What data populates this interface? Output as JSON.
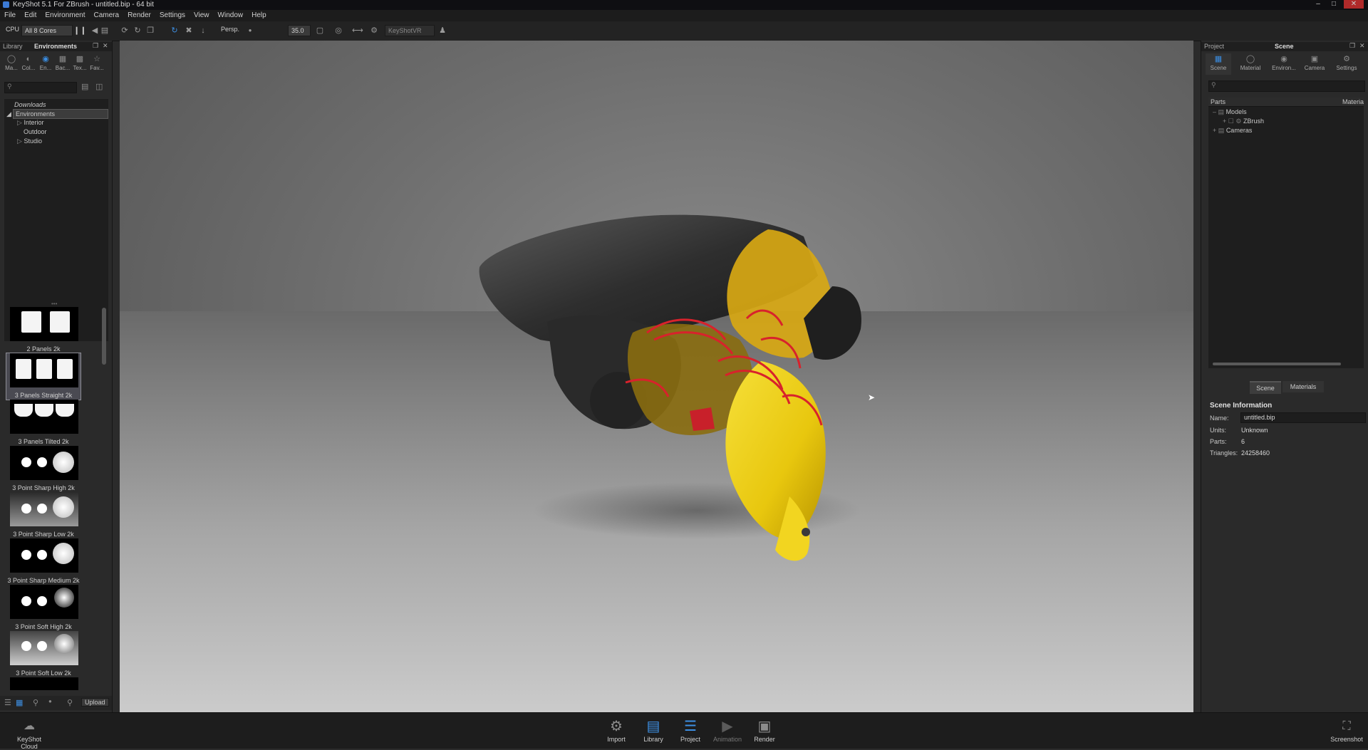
{
  "window": {
    "title": "KeyShot 5.1 For ZBrush - untitled.bip - 64 bit"
  },
  "menu": [
    "File",
    "Edit",
    "Environment",
    "Camera",
    "Render",
    "Settings",
    "View",
    "Window",
    "Help"
  ],
  "toolbar": {
    "cpu_label": "CPU",
    "cores_value": "All 8 Cores",
    "view_mode": "Persp.",
    "focal_length": "35.0",
    "keyshotvr_label": "KeyShotVR"
  },
  "left_panel": {
    "header_left": "Library",
    "header_title": "Environments",
    "tabs": [
      "Ma...",
      "Col...",
      "En...",
      "Bac...",
      "Tex...",
      "Fav..."
    ],
    "tree": {
      "downloads": "Downloads",
      "root": "Environments",
      "children": [
        "Interior",
        "Outdoor",
        "Studio"
      ]
    },
    "thumbnails": [
      "2 Panels 2k",
      "3 Panels Straight 2k",
      "3 Panels Tilted 2k",
      "3 Point Sharp High 2k",
      "3 Point Sharp Low 2k",
      "3 Point Sharp Medium 2k",
      "3 Point Soft High 2k",
      "3 Point Soft Low 2k"
    ],
    "upload_label": "Upload"
  },
  "right_panel": {
    "header_left": "Project",
    "header_title": "Scene",
    "tabs": [
      "Scene",
      "Material",
      "Environ...",
      "Camera",
      "Settings"
    ],
    "tree_columns": [
      "Parts",
      "Materia"
    ],
    "tree": {
      "models": "Models",
      "zbrush": "ZBrush",
      "cameras": "Cameras"
    },
    "subtabs": [
      "Scene",
      "Materials"
    ],
    "scene_info": {
      "heading": "Scene Information",
      "name_label": "Name:",
      "name_value": "untitled.bip",
      "units_label": "Units:",
      "units_value": "Unknown",
      "parts_label": "Parts:",
      "parts_value": "6",
      "triangles_label": "Triangles:",
      "triangles_value": "24258460"
    }
  },
  "bottom_bar": {
    "cloud": "KeyShot Cloud",
    "buttons": [
      "Import",
      "Library",
      "Project",
      "Animation",
      "Render"
    ],
    "screenshot": "Screenshot"
  },
  "colors": {
    "accent": "#3d8fe3",
    "model_yellow": "#f0d21a",
    "model_red": "#d8222c",
    "model_dark": "#2e2e2e"
  }
}
